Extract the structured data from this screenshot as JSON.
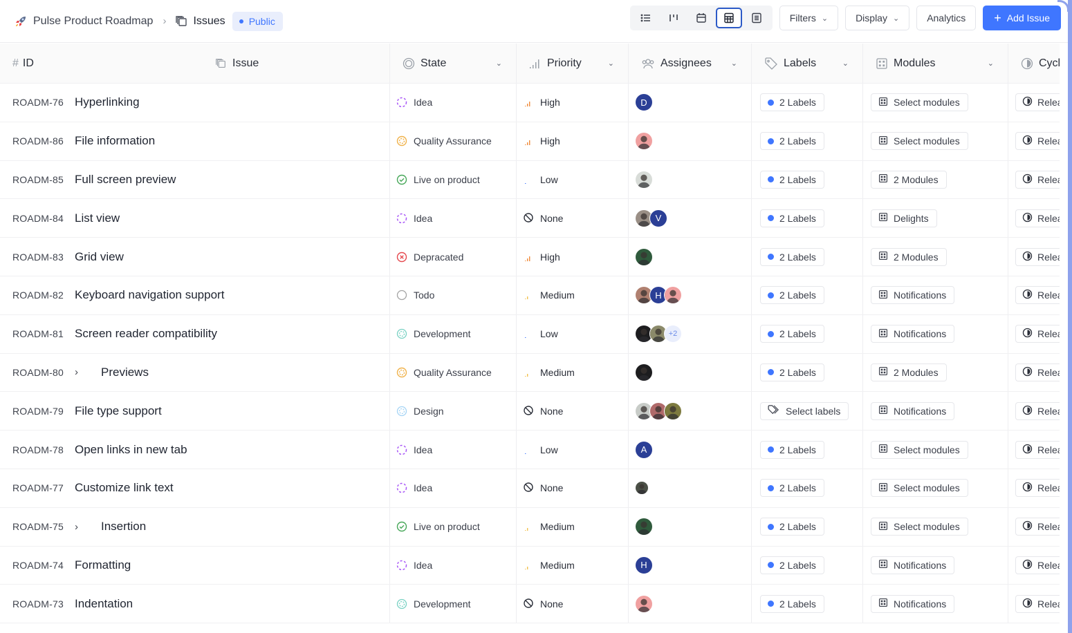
{
  "header": {
    "project_name": "Pulse Product Roadmap",
    "section": "Issues",
    "visibility_badge": "Public",
    "views": [
      {
        "name": "list-view",
        "active": false
      },
      {
        "name": "kanban-view",
        "active": false
      },
      {
        "name": "calendar-view",
        "active": false
      },
      {
        "name": "spreadsheet-view",
        "active": true
      },
      {
        "name": "gantt-view",
        "active": false
      }
    ],
    "filters_label": "Filters",
    "display_label": "Display",
    "analytics_label": "Analytics",
    "add_issue_label": "Add Issue"
  },
  "colors": {
    "accent": "#3f76ff",
    "idea": "#a855f7",
    "quality_assurance": "#f0b24b",
    "live_on_product": "#46a758",
    "depracated": "#e5484d",
    "todo": "#a3a3a3",
    "development": "#79d1c3",
    "design": "#a5d4f5",
    "priority_high": "#f08c3c",
    "priority_medium": "#f2c14e",
    "priority_low": "#3f76ff"
  },
  "table": {
    "columns": {
      "id": "ID",
      "issue": "Issue",
      "state": "State",
      "priority": "Priority",
      "assignees": "Assignees",
      "labels": "Labels",
      "modules": "Modules",
      "cycle": "Cycle"
    },
    "rows": [
      {
        "id": "ROADM-76",
        "title": "Hyperlinking",
        "has_children": false,
        "state": "Idea",
        "state_key": "idea",
        "priority": "High",
        "priority_key": "high",
        "assignees": [
          {
            "type": "initial",
            "text": "D"
          }
        ],
        "labels": "2 Labels",
        "labels_empty": false,
        "modules": "Select modules",
        "cycle": "Release"
      },
      {
        "id": "ROADM-86",
        "title": "File information",
        "has_children": false,
        "state": "Quality Assurance",
        "state_key": "qa",
        "priority": "High",
        "priority_key": "high",
        "assignees": [
          {
            "type": "photo",
            "color": "#f0a0a0"
          }
        ],
        "labels": "2 Labels",
        "labels_empty": false,
        "modules": "Select modules",
        "cycle": "Release"
      },
      {
        "id": "ROADM-85",
        "title": "Full screen preview",
        "has_children": false,
        "state": "Live on product",
        "state_key": "live",
        "priority": "Low",
        "priority_key": "low",
        "assignees": [
          {
            "type": "photo",
            "color": "#d8dcd8"
          }
        ],
        "labels": "2 Labels",
        "labels_empty": false,
        "modules": "2 Modules",
        "cycle": "Release"
      },
      {
        "id": "ROADM-84",
        "title": "List view",
        "has_children": false,
        "state": "Idea",
        "state_key": "idea",
        "priority": "None",
        "priority_key": "none",
        "assignees": [
          {
            "type": "photo",
            "color": "#9a8f86"
          },
          {
            "type": "initial",
            "text": "V"
          }
        ],
        "labels": "2 Labels",
        "labels_empty": false,
        "modules": "Delights",
        "cycle": "Release"
      },
      {
        "id": "ROADM-83",
        "title": "Grid view",
        "has_children": false,
        "state": "Depracated",
        "state_key": "depracated",
        "priority": "High",
        "priority_key": "high",
        "assignees": [
          {
            "type": "photo",
            "color": "#2f5a3c"
          }
        ],
        "labels": "2 Labels",
        "labels_empty": false,
        "modules": "2 Modules",
        "cycle": "Release"
      },
      {
        "id": "ROADM-82",
        "title": "Keyboard navigation support",
        "has_children": false,
        "state": "Todo",
        "state_key": "todo",
        "priority": "Medium",
        "priority_key": "medium",
        "assignees": [
          {
            "type": "photo",
            "color": "#b08070"
          },
          {
            "type": "initial",
            "text": "H"
          },
          {
            "type": "photo",
            "color": "#f0a0a0"
          }
        ],
        "labels": "2 Labels",
        "labels_empty": false,
        "modules": "Notifications",
        "cycle": "Release"
      },
      {
        "id": "ROADM-81",
        "title": "Screen reader compatibility",
        "has_children": false,
        "state": "Development",
        "state_key": "development",
        "priority": "Low",
        "priority_key": "low",
        "assignees": [
          {
            "type": "photo",
            "color": "#1d1d1f"
          },
          {
            "type": "photo",
            "color": "#8b8a6a"
          },
          {
            "type": "more",
            "text": "+2"
          }
        ],
        "labels": "2 Labels",
        "labels_empty": false,
        "modules": "Notifications",
        "cycle": "Release"
      },
      {
        "id": "ROADM-80",
        "title": "Previews",
        "has_children": true,
        "state": "Quality Assurance",
        "state_key": "qa",
        "priority": "Medium",
        "priority_key": "medium",
        "assignees": [
          {
            "type": "photo",
            "color": "#1d1d1f"
          }
        ],
        "labels": "2 Labels",
        "labels_empty": false,
        "modules": "2 Modules",
        "cycle": "Release"
      },
      {
        "id": "ROADM-79",
        "title": "File type support",
        "has_children": false,
        "state": "Design",
        "state_key": "design",
        "priority": "None",
        "priority_key": "none",
        "assignees": [
          {
            "type": "photo",
            "color": "#c8ccc8"
          },
          {
            "type": "photo",
            "color": "#b06a6a"
          },
          {
            "type": "photo",
            "color": "#7d7a3f"
          }
        ],
        "labels": "Select labels",
        "labels_empty": true,
        "modules": "Notifications",
        "cycle": "Release"
      },
      {
        "id": "ROADM-78",
        "title": "Open links in new tab",
        "has_children": false,
        "state": "Idea",
        "state_key": "idea",
        "priority": "Low",
        "priority_key": "low",
        "assignees": [
          {
            "type": "initial",
            "text": "A"
          }
        ],
        "labels": "2 Labels",
        "labels_empty": false,
        "modules": "Select modules",
        "cycle": "Release"
      },
      {
        "id": "ROADM-77",
        "title": "Customize link text",
        "has_children": false,
        "state": "Idea",
        "state_key": "idea",
        "priority": "None",
        "priority_key": "none",
        "assignees": [
          {
            "type": "photo-small",
            "color": "#4a4f46"
          }
        ],
        "labels": "2 Labels",
        "labels_empty": false,
        "modules": "Select modules",
        "cycle": "Release"
      },
      {
        "id": "ROADM-75",
        "title": "Insertion",
        "has_children": true,
        "state": "Live on product",
        "state_key": "live",
        "priority": "Medium",
        "priority_key": "medium",
        "assignees": [
          {
            "type": "photo",
            "color": "#2f5a3c"
          }
        ],
        "labels": "2 Labels",
        "labels_empty": false,
        "modules": "Select modules",
        "cycle": "Release"
      },
      {
        "id": "ROADM-74",
        "title": "Formatting",
        "has_children": false,
        "state": "Idea",
        "state_key": "idea",
        "priority": "Medium",
        "priority_key": "medium",
        "assignees": [
          {
            "type": "initial",
            "text": "H"
          }
        ],
        "labels": "2 Labels",
        "labels_empty": false,
        "modules": "Notifications",
        "cycle": "Release"
      },
      {
        "id": "ROADM-73",
        "title": "Indentation",
        "has_children": false,
        "state": "Development",
        "state_key": "development",
        "priority": "None",
        "priority_key": "none",
        "assignees": [
          {
            "type": "photo",
            "color": "#f0a0a0"
          }
        ],
        "labels": "2 Labels",
        "labels_empty": false,
        "modules": "Notifications",
        "cycle": "Release"
      }
    ]
  }
}
